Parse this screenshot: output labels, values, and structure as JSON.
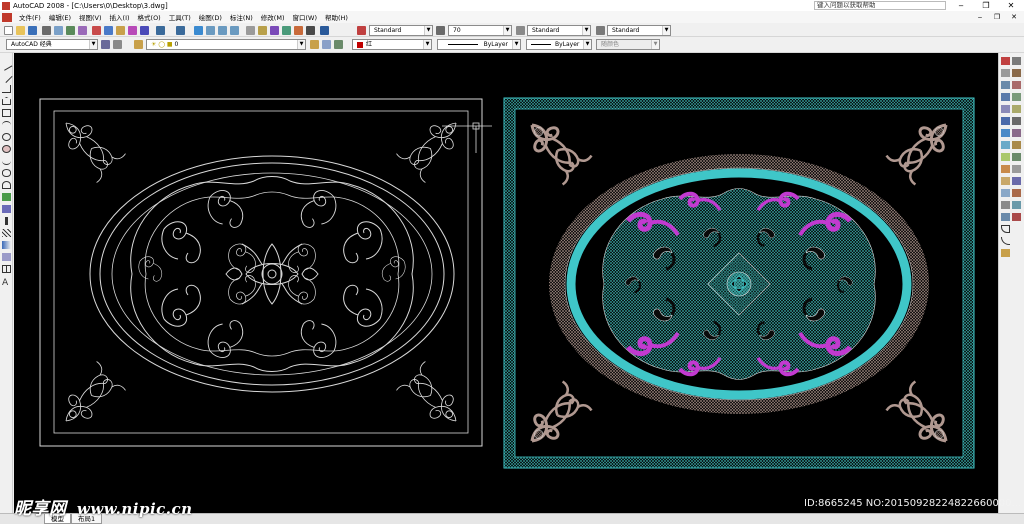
{
  "window": {
    "title": "AutoCAD 2008 - [C:\\Users\\0\\Desktop\\3.dwg]",
    "search_placeholder": "键入问题以获取帮助",
    "controls": [
      "‒",
      "❐",
      "✕"
    ]
  },
  "menubar": {
    "items": [
      "文件(F)",
      "编辑(E)",
      "视图(V)",
      "插入(I)",
      "格式(O)",
      "工具(T)",
      "绘图(D)",
      "标注(N)",
      "修改(M)",
      "窗口(W)",
      "帮助(H)"
    ],
    "mdi_controls": [
      "‒",
      "❐",
      "✕"
    ]
  },
  "toolbar1": {
    "text_style": "Standard",
    "text_height": "70",
    "dim_style": "Standard",
    "table_style": "Standard"
  },
  "toolbar2": {
    "workspace": "AutoCAD 经典",
    "layer": "0",
    "color": "红",
    "linetype": "ByLayer",
    "lineweight": "ByLayer",
    "plotstyle": "随颜色"
  },
  "colors": {
    "canvas": "#000000",
    "line_white": "#d9d9d9",
    "hatch_teal": "#3aa8a6",
    "ring_cyan": "#3fc6c8",
    "accent_magenta": "#c23ad0",
    "hatch_brown": "#a08a82",
    "layer_color_swatch": "#c00000"
  },
  "layout_tabs": [
    "模型",
    "布局1"
  ],
  "watermark": {
    "logo": "昵享网",
    "url": "www.nipic.cn"
  },
  "image_id": "ID:8665245 NO:20150928224822660000..."
}
